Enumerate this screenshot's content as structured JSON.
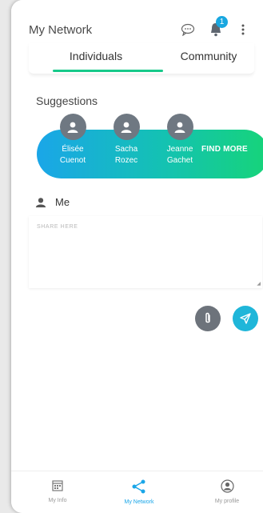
{
  "header": {
    "title": "My Network",
    "notification_count": "1"
  },
  "tabs": [
    {
      "label": "Individuals"
    },
    {
      "label": "Community"
    }
  ],
  "suggestions": {
    "title": "Suggestions",
    "people": [
      {
        "first": "Élisée",
        "last": "Cuenot"
      },
      {
        "first": "Sacha",
        "last": "Rozec"
      },
      {
        "first": "Jeanne",
        "last": "Gachet"
      }
    ],
    "find_more": "FIND MORE"
  },
  "composer": {
    "me_label": "Me",
    "placeholder": "SHARE HERE"
  },
  "bottom_nav": [
    {
      "label": "My Info",
      "icon": "calendar-icon"
    },
    {
      "label": "My Network",
      "icon": "share-icon"
    },
    {
      "label": "My profile",
      "icon": "user-circle-icon"
    }
  ],
  "colors": {
    "accent": "#17c98a",
    "blue": "#1aa6e8",
    "badge": "#19a7e0"
  }
}
